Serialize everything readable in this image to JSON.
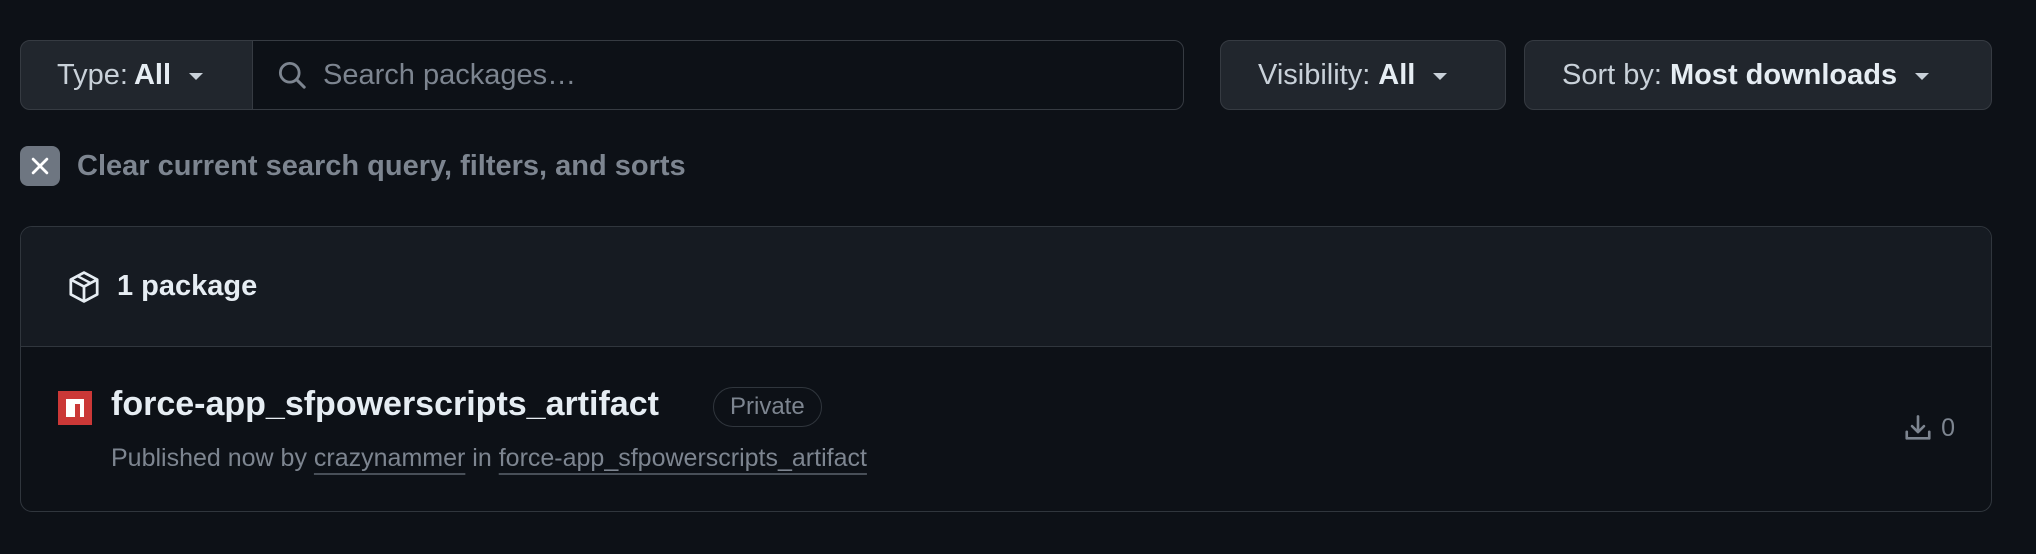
{
  "filters": {
    "type_label": "Type:",
    "type_value": "All",
    "search_placeholder": "Search packages…",
    "visibility_label": "Visibility:",
    "visibility_value": "All",
    "sort_label": "Sort by:",
    "sort_value": "Most downloads"
  },
  "clear": {
    "label": "Clear current search query, filters, and sorts"
  },
  "packages": {
    "count_label": "1 package",
    "items": [
      {
        "name": "force-app_sfpowerscripts_artifact",
        "visibility_badge": "Private",
        "published_prefix": "Published now by",
        "publisher": "crazynammer",
        "in_word": "in",
        "repository": "force-app_sfpowerscripts_artifact",
        "downloads": "0",
        "registry_icon": "npm-icon"
      }
    ]
  },
  "colors": {
    "background": "#0d1117",
    "button_bg": "#21262d",
    "border": "#30363d",
    "muted_text": "#7d8590",
    "npm_red": "#cb3837"
  }
}
